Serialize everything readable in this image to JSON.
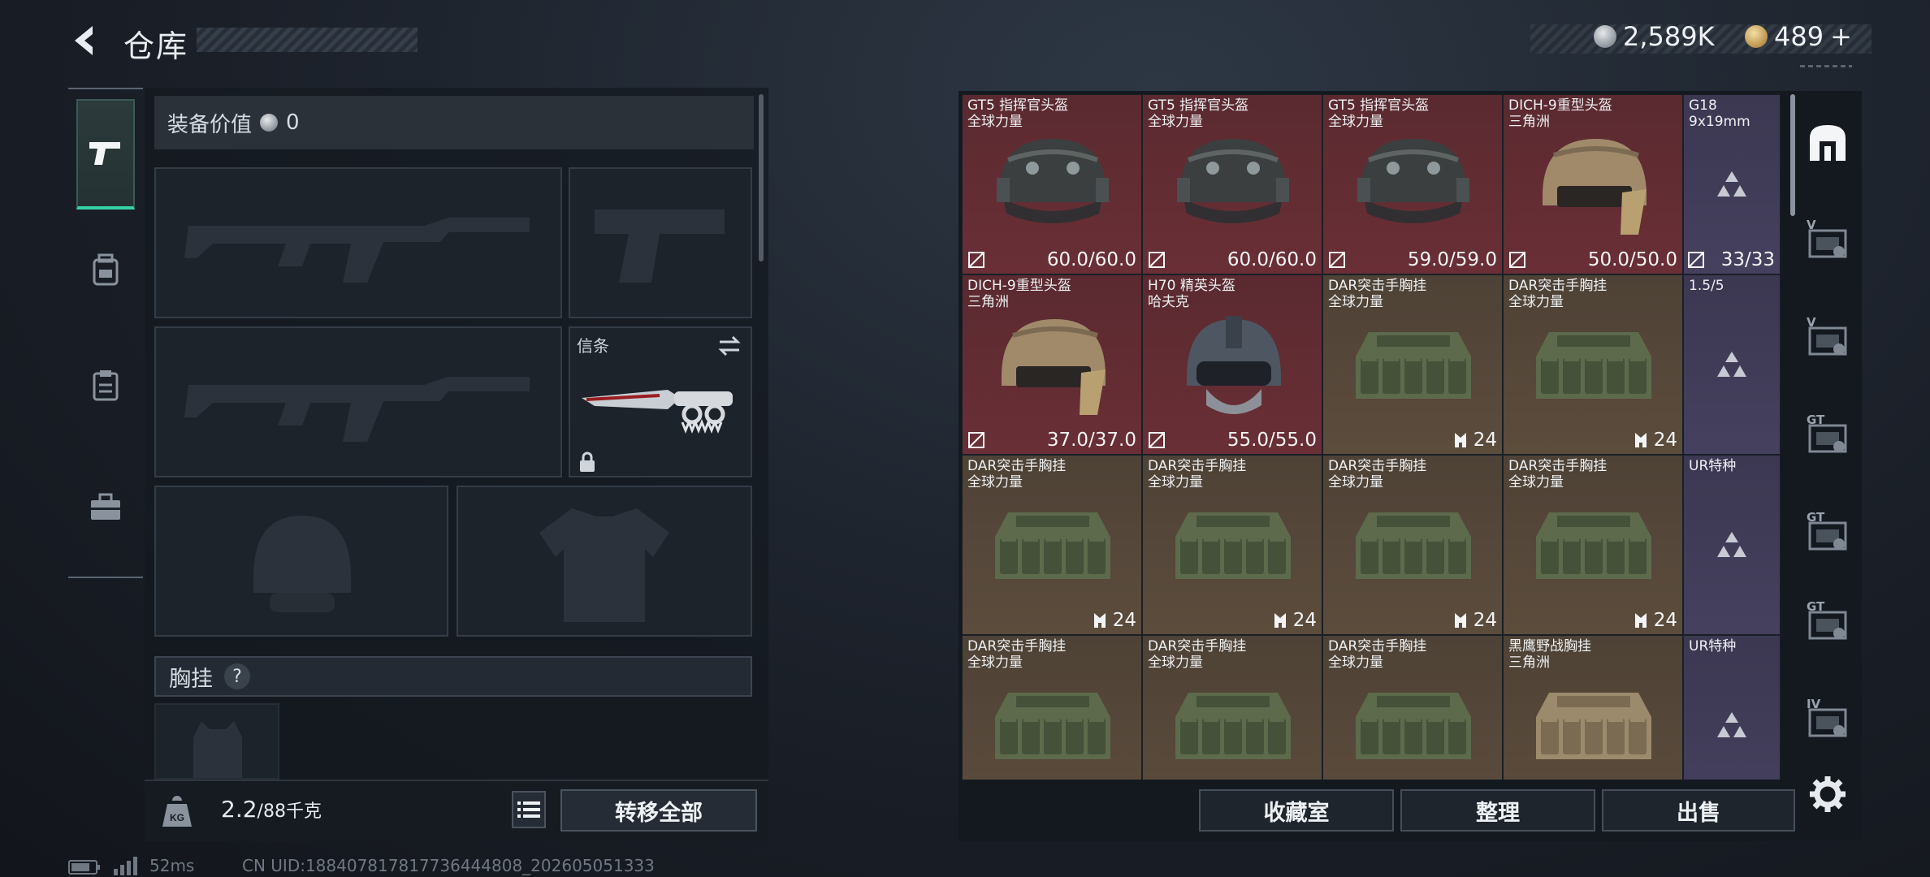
{
  "header": {
    "title": "仓库",
    "silver_amount": "2,589K",
    "gold_amount": "489",
    "gold_plus": "+"
  },
  "left_tabs": [
    {
      "icon": "pistol-icon",
      "active": true
    },
    {
      "icon": "backpack-icon",
      "active": false
    },
    {
      "icon": "clipboard-icon",
      "active": false
    },
    {
      "icon": "toolbox-icon",
      "active": false
    }
  ],
  "equipment": {
    "value_label": "装备价值",
    "value": "0",
    "melee_label": "信条",
    "chest_label": "胸挂",
    "help_symbol": "?"
  },
  "footer": {
    "weight_value": "2.2",
    "weight_max": "/88千克",
    "transfer_all": "转移全部"
  },
  "status_bar": {
    "ping": "52ms",
    "uid": "CN UID:18840781781773644480​8_202605051333"
  },
  "grid": {
    "rows": [
      [
        {
          "name": "GT5 指挥官头盔",
          "sub": "全球力量",
          "value": "60.0/60.0",
          "bg": "red",
          "kind": "helmet-black",
          "icon": "durability-icon"
        },
        {
          "name": "GT5 指挥官头盔",
          "sub": "全球力量",
          "value": "60.0/60.0",
          "bg": "red",
          "kind": "helmet-black",
          "icon": "durability-icon"
        },
        {
          "name": "GT5 指挥官头盔",
          "sub": "全球力量",
          "value": "59.0/59.0",
          "bg": "red",
          "kind": "helmet-black",
          "icon": "durability-icon"
        },
        {
          "name": "DICH-9重型头盔",
          "sub": "三角洲",
          "value": "50.0/50.0",
          "bg": "red",
          "kind": "helmet-tan",
          "icon": "durability-icon"
        },
        {
          "name": "G18",
          "sub": "9x19mm",
          "value": "33/33",
          "bg": "purple",
          "kind": "triangle",
          "icon": "durability-icon"
        }
      ],
      [
        {
          "name": "DICH-9重型头盔",
          "sub": "三角洲",
          "value": "37.0/37.0",
          "bg": "red",
          "kind": "helmet-tan",
          "icon": "durability-icon"
        },
        {
          "name": "H70 精英头盔",
          "sub": "哈夫克",
          "value": "55.0/55.0",
          "bg": "red",
          "kind": "helmet-grey",
          "icon": "durability-icon"
        },
        {
          "name": "DAR突击手胸挂",
          "sub": "全球力量",
          "value": "24",
          "bg": "brown",
          "kind": "rig-green",
          "icon": "capacity-icon"
        },
        {
          "name": "DAR突击手胸挂",
          "sub": "全球力量",
          "value": "24",
          "bg": "brown",
          "kind": "rig-green",
          "icon": "capacity-icon"
        },
        {
          "name": "1.5/5",
          "sub": "",
          "value": "",
          "bg": "purple",
          "kind": "triangle",
          "icon": ""
        }
      ],
      [
        {
          "name": "DAR突击手胸挂",
          "sub": "全球力量",
          "value": "24",
          "bg": "brown",
          "kind": "rig-green",
          "icon": "capacity-icon"
        },
        {
          "name": "DAR突击手胸挂",
          "sub": "全球力量",
          "value": "24",
          "bg": "brown",
          "kind": "rig-green",
          "icon": "capacity-icon"
        },
        {
          "name": "DAR突击手胸挂",
          "sub": "全球力量",
          "value": "24",
          "bg": "brown",
          "kind": "rig-green",
          "icon": "capacity-icon"
        },
        {
          "name": "DAR突击手胸挂",
          "sub": "全球力量",
          "value": "24",
          "bg": "brown",
          "kind": "rig-green",
          "icon": "capacity-icon"
        },
        {
          "name": "UR特种",
          "sub": "",
          "value": "",
          "bg": "purple",
          "kind": "triangle",
          "icon": ""
        }
      ],
      [
        {
          "name": "DAR突击手胸挂",
          "sub": "全球力量",
          "value": "",
          "bg": "brown",
          "kind": "rig-green",
          "icon": ""
        },
        {
          "name": "DAR突击手胸挂",
          "sub": "全球力量",
          "value": "",
          "bg": "brown",
          "kind": "rig-green",
          "icon": ""
        },
        {
          "name": "DAR突击手胸挂",
          "sub": "全球力量",
          "value": "",
          "bg": "brown",
          "kind": "rig-green",
          "icon": ""
        },
        {
          "name": "黑鹰野战胸挂",
          "sub": "三角洲",
          "value": "",
          "bg": "brown",
          "kind": "rig-tan",
          "icon": ""
        },
        {
          "name": "UR特种",
          "sub": "",
          "value": "",
          "bg": "purple",
          "kind": "triangle",
          "icon": ""
        }
      ]
    ]
  },
  "right_tools": [
    {
      "icon": "storage-icon",
      "label": ""
    },
    {
      "icon": "warehouse-v-icon",
      "label": "V"
    },
    {
      "icon": "warehouse-v-edit-icon",
      "label": "V"
    },
    {
      "icon": "warehouse-gt-icon",
      "label": "GT"
    },
    {
      "icon": "warehouse-gt-edit-icon",
      "label": "GT"
    },
    {
      "icon": "warehouse-gt-alt-icon",
      "label": "GT"
    },
    {
      "icon": "warehouse-iv-add-icon",
      "label": "IV"
    },
    {
      "icon": "settings-icon",
      "label": ""
    }
  ],
  "grid_buttons": {
    "collection": "收藏室",
    "organize": "整理",
    "sell": "出售"
  },
  "colors": {
    "accent": "#34d3a6",
    "red_cell": "#6a2f36",
    "brown_cell": "#5c4c3c",
    "purple_cell": "#44405e"
  }
}
